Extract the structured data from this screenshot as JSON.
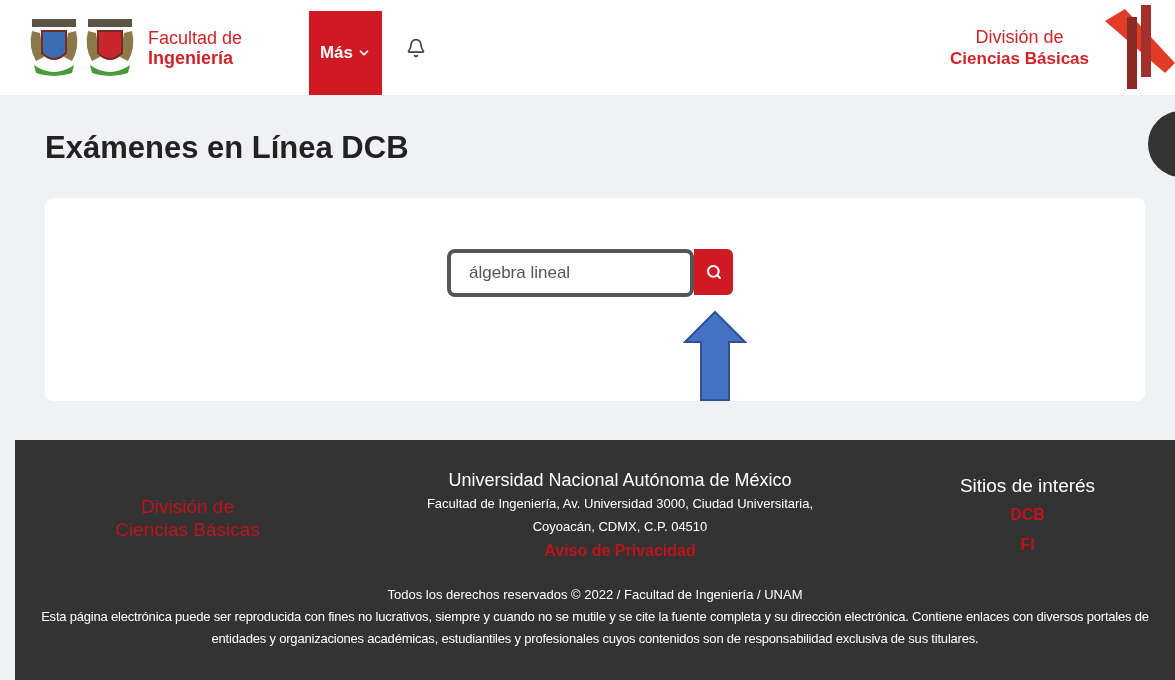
{
  "header": {
    "faculty_logo": {
      "line_1": "Facultad de",
      "line_2": "Ingeniería"
    },
    "menu_button": {
      "label": "Más"
    },
    "division_logo": {
      "line_1": "División de",
      "line_2": "Ciencias Básicas"
    }
  },
  "page": {
    "title": "Exámenes en Línea DCB",
    "search": {
      "value": "álgebra lineal"
    }
  },
  "footer": {
    "division": {
      "line_1": "División de",
      "line_2": "Ciencias Básicas"
    },
    "address": {
      "university": "Universidad Nacional Autónoma de México",
      "line_1": "Facultad de Ingeniería, Av. Universidad 3000, Ciudad Universitaria,",
      "line_2": "Coyoacán, CDMX, C.P. 04510",
      "privacy_link": "Aviso de Privacidad"
    },
    "links": {
      "title": "Sitios de interés",
      "items": [
        "DCB",
        "FI"
      ]
    },
    "copyright": "Todos los derechos reservados © 2022 / Facultad de Ingeniería / UNAM",
    "notice": "Esta página electrónica puede ser reproducida con fines no lucrativos, siempre y cuando no se mutile y se cite la fuente completa y su dirección electrónica. Contiene enlaces con diversos portales de entidades y organizaciones académicas, estudiantiles y profesionales cuyos contenidos son de responsabilidad exclusiva de sus titulares."
  }
}
